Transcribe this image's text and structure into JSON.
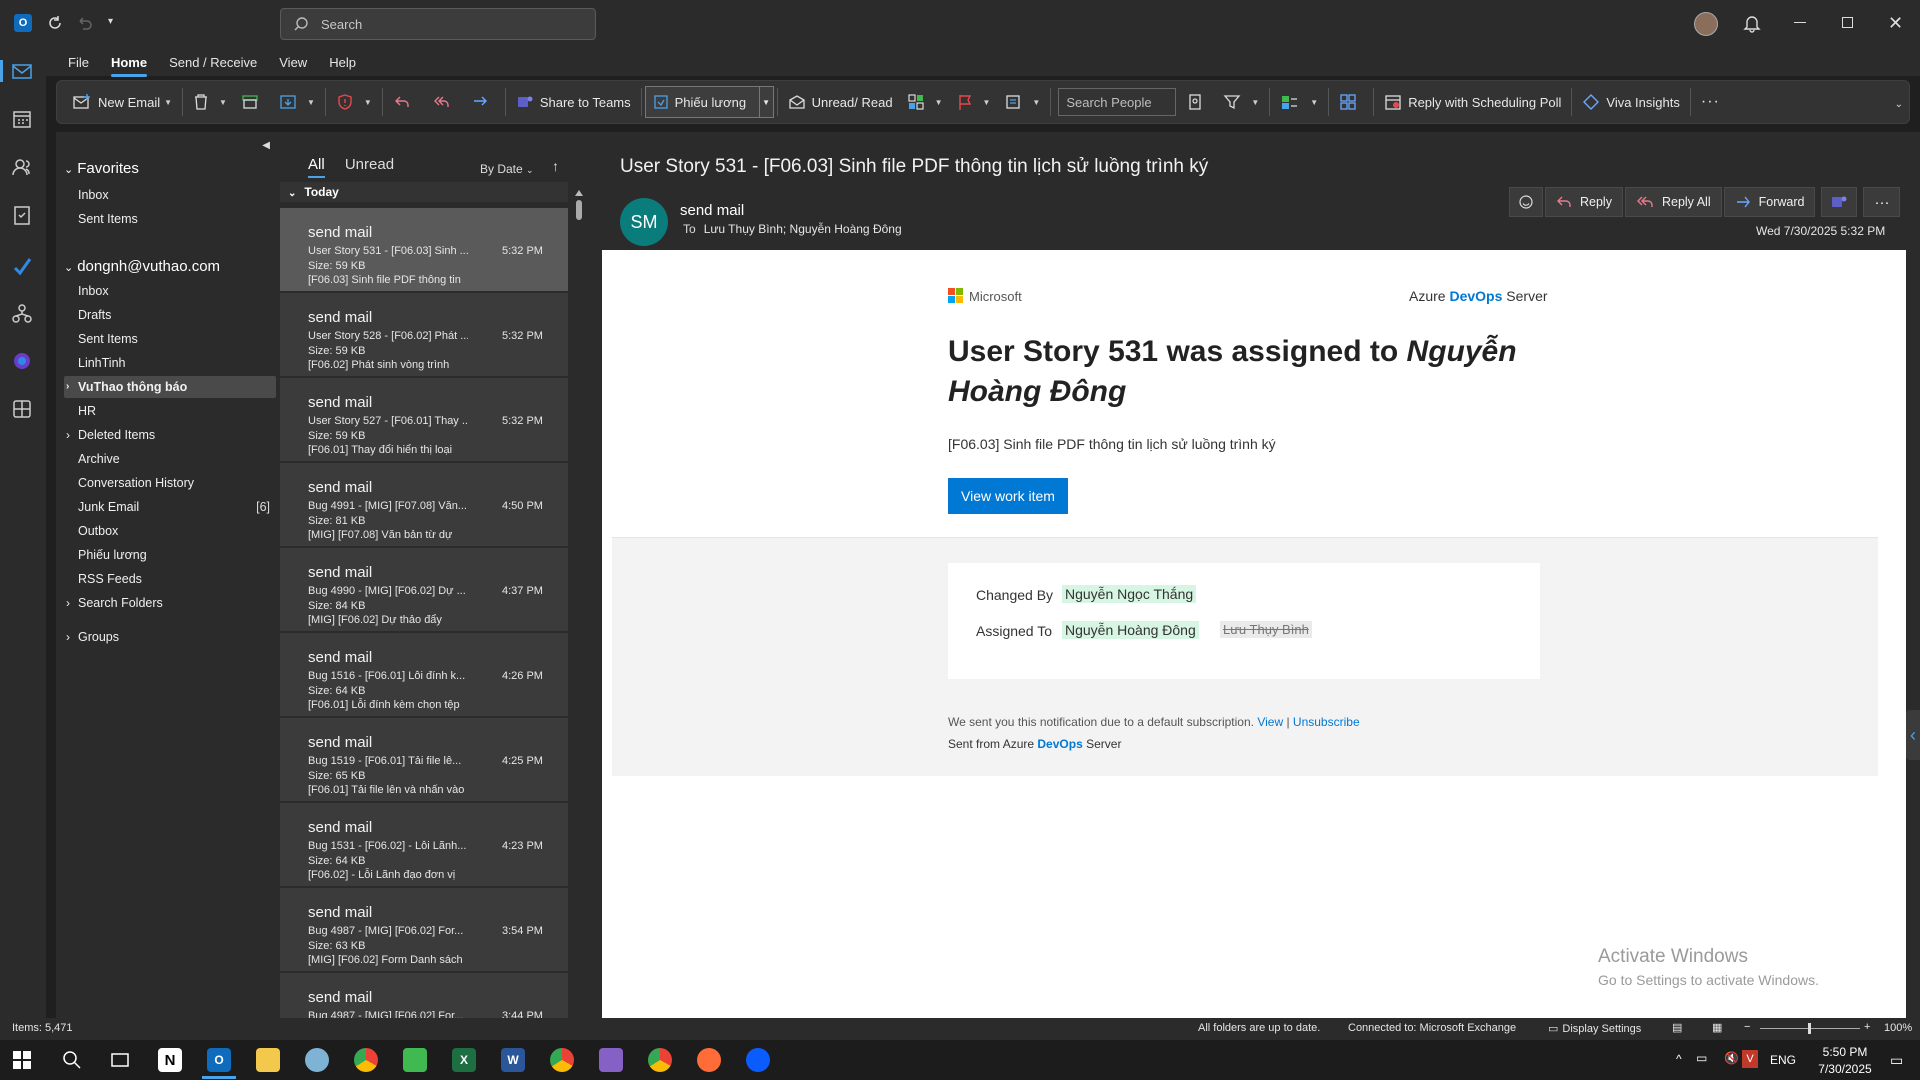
{
  "search": {
    "placeholder": "Search"
  },
  "menu": {
    "items": [
      "File",
      "Home",
      "Send / Receive",
      "View",
      "Help"
    ]
  },
  "ribbon": {
    "new_email": "New Email",
    "share_teams": "Share to Teams",
    "category": "Phiếu lương",
    "unread_read": "Unread/ Read",
    "search_people": "Search People",
    "reply_poll": "Reply with Scheduling Poll",
    "viva": "Viva Insights"
  },
  "folders": {
    "favorites_header": "Favorites",
    "favorites": [
      "Inbox",
      "Sent Items"
    ],
    "account": "dongnh@vuthao.com",
    "items": [
      {
        "label": "Inbox",
        "count": ""
      },
      {
        "label": "Drafts",
        "count": ""
      },
      {
        "label": "Sent Items",
        "count": ""
      },
      {
        "label": "LinhTinh",
        "count": ""
      },
      {
        "label": "VuThao thông báo",
        "count": "",
        "selected": true,
        "expand": true
      },
      {
        "label": "HR",
        "count": ""
      },
      {
        "label": "Deleted Items",
        "count": "",
        "expand": true
      },
      {
        "label": "Archive",
        "count": ""
      },
      {
        "label": "Conversation History",
        "count": ""
      },
      {
        "label": "Junk Email",
        "count": "[6]"
      },
      {
        "label": "Outbox",
        "count": ""
      },
      {
        "label": "Phiếu lương",
        "count": ""
      },
      {
        "label": "RSS Feeds",
        "count": ""
      },
      {
        "label": "Search Folders",
        "count": "",
        "expand": true
      }
    ],
    "groups": "Groups"
  },
  "list": {
    "tab_all": "All",
    "tab_unread": "Unread",
    "sort": "By Date",
    "group": "Today",
    "messages": [
      {
        "from": "send mail",
        "subject": "User Story 531 - [F06.03] Sinh ...",
        "time": "5:32 PM",
        "size": "Size: 59 KB",
        "preview": "[F06.03] Sinh file PDF thông tin"
      },
      {
        "from": "send mail",
        "subject": "User Story 528 - [F06.02] Phát ...",
        "time": "5:32 PM",
        "size": "Size: 59 KB",
        "preview": "[F06.02] Phát sinh vòng trình"
      },
      {
        "from": "send mail",
        "subject": "User Story 527 - [F06.01] Thay ...",
        "time": "5:32 PM",
        "size": "Size: 59 KB",
        "preview": "[F06.01] Thay đổi hiển thị loại"
      },
      {
        "from": "send mail",
        "subject": "Bug 4991 - [MIG] [F07.08] Văn...",
        "time": "4:50 PM",
        "size": "Size: 81 KB",
        "preview": "[MIG] [F07.08] Văn bản từ dự"
      },
      {
        "from": "send mail",
        "subject": "Bug 4990 - [MIG] [F06.02] Dự ...",
        "time": "4:37 PM",
        "size": "Size: 84 KB",
        "preview": "[MIG] [F06.02] Dự thảo đẩy"
      },
      {
        "from": "send mail",
        "subject": "Bug 1516 - [F06.01] Lỗi đính k...",
        "time": "4:26 PM",
        "size": "Size: 64 KB",
        "preview": "[F06.01] Lỗi đính kèm chọn tệp"
      },
      {
        "from": "send mail",
        "subject": "Bug 1519 - [F06.01] Tải file lê...",
        "time": "4:25 PM",
        "size": "Size: 65 KB",
        "preview": "[F06.01] Tải file lên và nhấn vào"
      },
      {
        "from": "send mail",
        "subject": "Bug 1531 - [F06.02] - Lỗi Lãnh...",
        "time": "4:23 PM",
        "size": "Size: 64 KB",
        "preview": "[F06.02] - Lỗi Lãnh đạo đơn vị"
      },
      {
        "from": "send mail",
        "subject": "Bug 4987 - [MIG] [F06.02] For...",
        "time": "3:54 PM",
        "size": "Size: 63 KB",
        "preview": "[MIG] [F06.02] Form Danh sách"
      },
      {
        "from": "send mail",
        "subject": "Bug 4987 - [MIG] [F06.02] For...",
        "time": "3:44 PM",
        "size": "",
        "preview": ""
      }
    ]
  },
  "reading": {
    "subject": "User Story 531 - [F06.03] Sinh file PDF thông tin lịch sử luồng trình ký",
    "avatar": "SM",
    "sender": "send mail",
    "to_label": "To",
    "to": "Lưu Thụy Bình; Nguyễn Hoàng Đông",
    "reply": "Reply",
    "reply_all": "Reply All",
    "forward": "Forward",
    "date": "Wed 7/30/2025 5:32 PM"
  },
  "mail": {
    "ms_brand": "Microsoft",
    "azure": "Azure",
    "devops": "DevOps",
    "server": "Server",
    "headline_pre": "User Story 531 was assigned to ",
    "headline_name": "Nguyễn Hoàng Đông",
    "desc": "[F06.03] Sinh file PDF thông tin lịch sử luồng trình ký",
    "button": "View work item",
    "changed_by_label": "Changed By",
    "changed_by": "Nguyễn Ngọc Thắng",
    "assigned_to_label": "Assigned To",
    "assigned_to": "Nguyễn Hoàng Đông",
    "assigned_old": "Lưu Thụy Bình",
    "notice": "We sent you this notification due to a default subscription.",
    "view_link": "View",
    "pipe": "|",
    "unsub": "Unsubscribe",
    "sent_from": "Sent from Azure",
    "sent_devops": "DevOps",
    "sent_server": "Server"
  },
  "watermark": {
    "line1": "Activate Windows",
    "line2": "Go to Settings to activate Windows."
  },
  "status": {
    "items": "Items: 5,471",
    "uptodate": "All folders are up to date.",
    "connected": "Connected to: Microsoft Exchange",
    "display": "Display Settings",
    "zoom": "100%"
  },
  "taskbar": {
    "lang": "ENG",
    "time": "5:50 PM",
    "date": "7/30/2025"
  },
  "colors": {
    "accent": "#0078d4",
    "highlight": "#d6f5e3",
    "avatar": "#0b7c7c"
  }
}
